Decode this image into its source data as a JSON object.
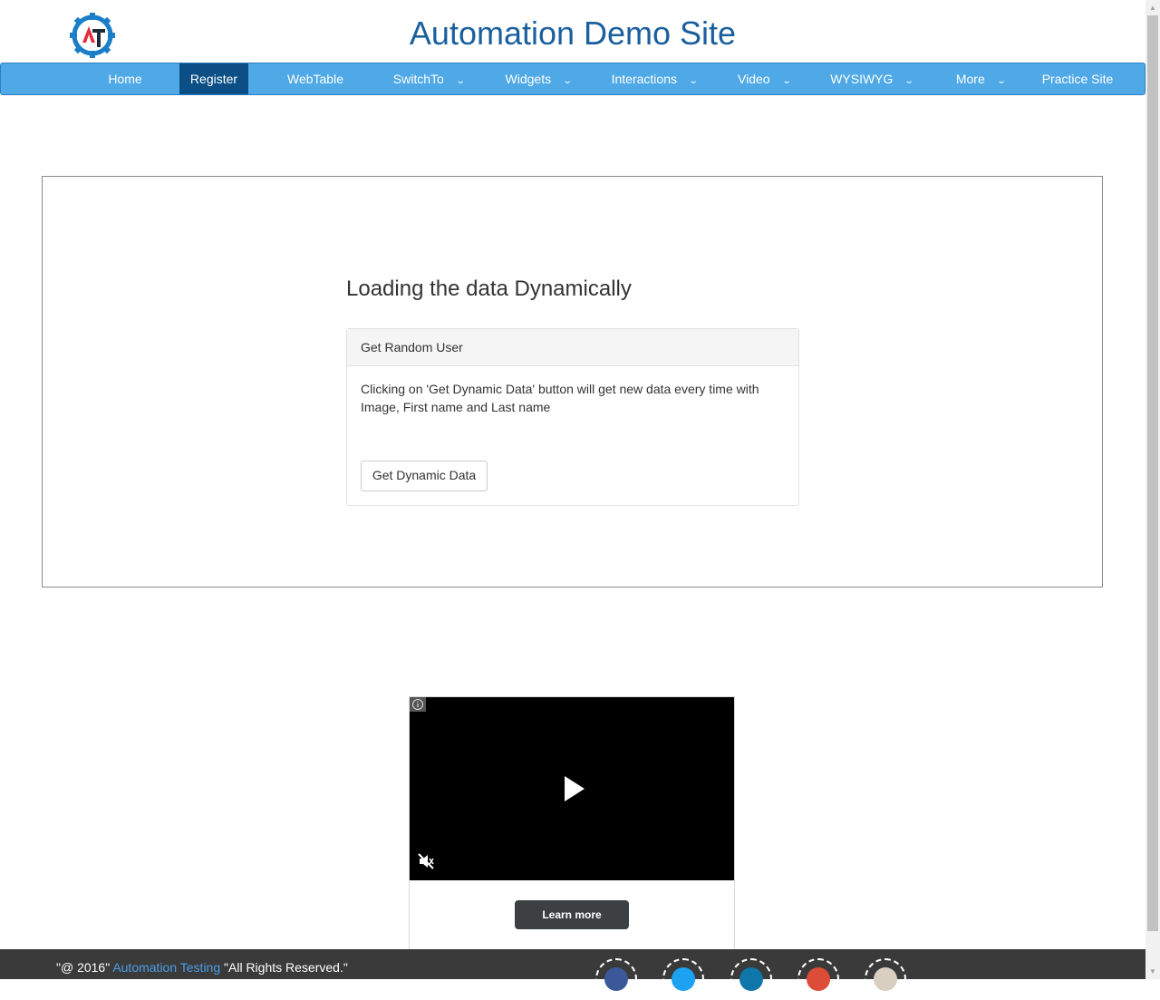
{
  "site": {
    "title": "Automation Demo Site"
  },
  "nav": {
    "items": [
      {
        "label": "Home",
        "has_dropdown": false,
        "active": false
      },
      {
        "label": "Register",
        "has_dropdown": false,
        "active": true
      },
      {
        "label": "WebTable",
        "has_dropdown": false,
        "active": false
      },
      {
        "label": "SwitchTo",
        "has_dropdown": true,
        "active": false
      },
      {
        "label": "Widgets",
        "has_dropdown": true,
        "active": false
      },
      {
        "label": "Interactions",
        "has_dropdown": true,
        "active": false
      },
      {
        "label": "Video",
        "has_dropdown": true,
        "active": false
      },
      {
        "label": "WYSIWYG",
        "has_dropdown": true,
        "active": false
      },
      {
        "label": "More",
        "has_dropdown": true,
        "active": false
      },
      {
        "label": "Practice Site",
        "has_dropdown": false,
        "active": false
      }
    ]
  },
  "main": {
    "title": "Loading the data Dynamically",
    "panel": {
      "heading": "Get Random User",
      "description": "Clicking on 'Get Dynamic Data' button will get new data every time with Image, First name and Last name",
      "button_label": "Get Dynamic Data"
    }
  },
  "ad": {
    "learn_more_label": "Learn more",
    "icons": [
      "info-icon",
      "play-icon",
      "mute-icon"
    ]
  },
  "footer": {
    "prefix": "\"@ 2016\" ",
    "link_text": "Automation Testing",
    "suffix": " \"All Rights Reserved.\"",
    "social_icons": [
      "facebook-icon",
      "twitter-icon",
      "linkedin-icon",
      "google-plus-icon",
      "youtube-icon"
    ]
  },
  "colors": {
    "nav_bg": "#4fa9e6",
    "nav_active": "#0b4f86",
    "title": "#1a5f9e",
    "footer_bg": "#3a3a3a",
    "footer_link": "#4c9ee8"
  }
}
